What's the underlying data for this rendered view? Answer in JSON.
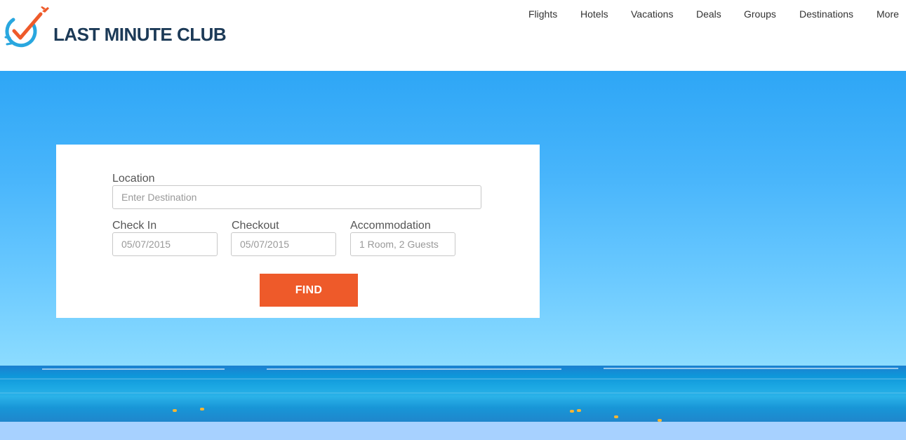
{
  "brand": {
    "name": "LAST MINUTE CLUB",
    "primary_color": "#1c3a57",
    "accent_color": "#ee5a2a",
    "logo_icon": "clock-checkmark-plane-icon"
  },
  "nav": {
    "items": [
      {
        "label": "Flights"
      },
      {
        "label": "Hotels"
      },
      {
        "label": "Vacations"
      },
      {
        "label": "Deals"
      },
      {
        "label": "Groups"
      },
      {
        "label": "Destinations"
      },
      {
        "label": "More"
      }
    ]
  },
  "search": {
    "location_label": "Location",
    "location_placeholder": "Enter Destination",
    "checkin_label": "Check In",
    "checkin_value": "05/07/2015",
    "checkout_label": "Checkout",
    "checkout_value": "05/07/2015",
    "accommodation_label": "Accommodation",
    "accommodation_value": "1 Room, 2 Guests",
    "find_label": "FIND"
  },
  "hero": {
    "background_image": "ocean-horizon-sky"
  }
}
